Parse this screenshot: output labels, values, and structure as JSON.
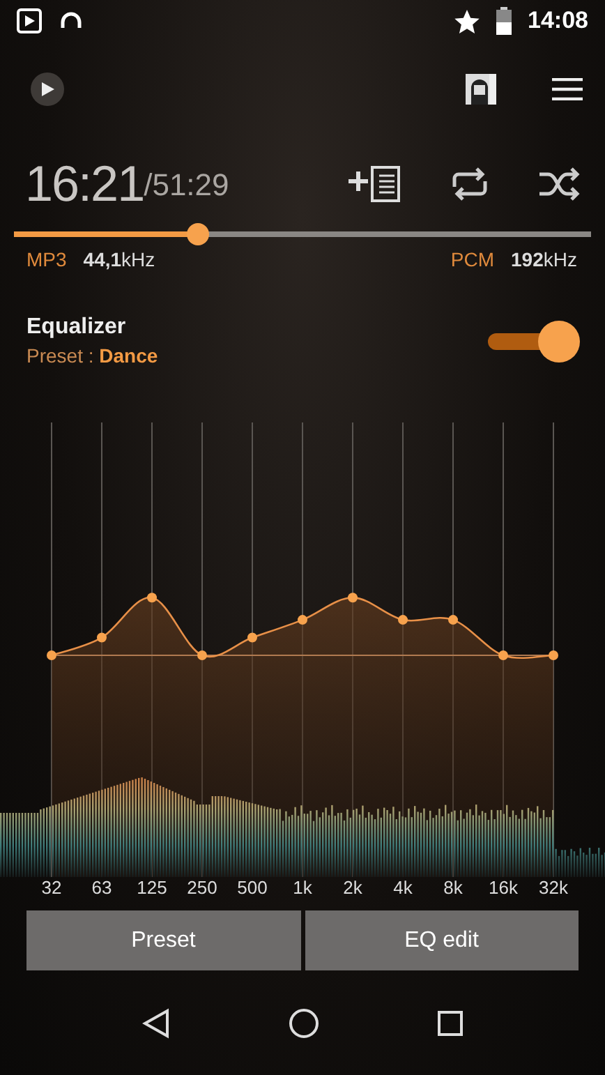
{
  "status_bar": {
    "time": "14:08"
  },
  "player": {
    "elapsed": "16:21",
    "total": "/51:29",
    "progress": {
      "level": 0.32
    },
    "source_format": "MP3",
    "source_rate": "44,1",
    "source_unit": "kHz",
    "output_format": "PCM",
    "output_rate": "192",
    "output_unit": "kHz"
  },
  "equalizer": {
    "title": "Equalizer",
    "preset_label": "Preset : ",
    "preset": "Dance",
    "on": true,
    "bands": [
      {
        "label": "32"
      },
      {
        "label": "63"
      },
      {
        "label": "125"
      },
      {
        "label": "250"
      },
      {
        "label": "500"
      },
      {
        "label": "1k"
      },
      {
        "label": "2k"
      },
      {
        "label": "4k"
      },
      {
        "label": "8k"
      },
      {
        "label": "16k"
      },
      {
        "label": "32k"
      }
    ]
  },
  "buttons": [
    "Preset",
    "EQ edit"
  ]
}
